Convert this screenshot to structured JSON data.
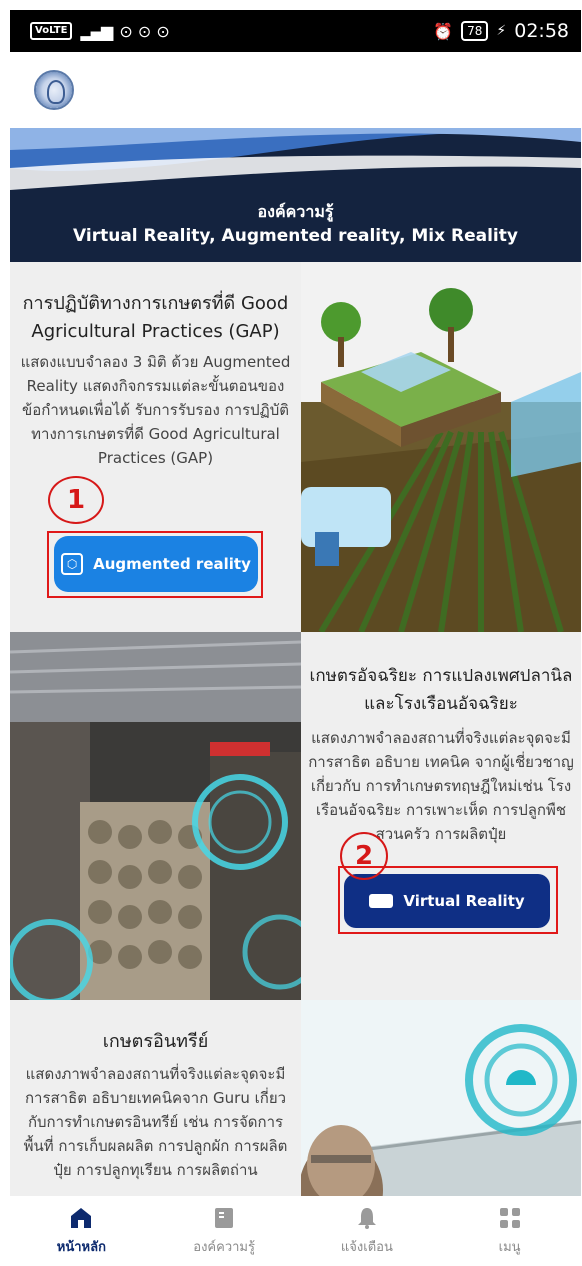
{
  "status_bar": {
    "left_badge": "VoLTE",
    "signal": "📶",
    "icons": "⊙ ⊙ ⊙",
    "battery": "78",
    "time": "02:58"
  },
  "banner": {
    "title": "องค์ความรู้",
    "subtitle": "Virtual Reality, Augmented reality, Mix Reality"
  },
  "cards": [
    {
      "title": "การปฏิบัติทางการเกษตรที่ดี Good Agricultural Practices (GAP)",
      "description": "แสดงแบบจำลอง 3 มิติ ด้วย Augmented Reality แสดงกิจกรรมแต่ละขั้นตอนของข้อกำหนดเพื่อได้ รับการรับรอง การปฏิบัติทางการเกษตรที่ดี Good Agricultural Practices (GAP)",
      "button": "Augmented reality",
      "marker": "1"
    },
    {
      "title": "เกษตรอัจฉริยะ การแปลงเพศปลานิล และโรงเรือนอัจฉริยะ",
      "description": "แสดงภาพจำลองสถานที่จริงแต่ละจุดจะมีการสาธิต อธิบาย เทคนิค จากผู้เชี่ยวชาญเกี่ยวกับ การทำเกษตรทฤษฎีใหม่เช่น โรงเรือนอัจฉริยะ การเพาะเห็ด การปลูกพืชสวนครัว การผลิตปุ๋ย",
      "button": "Virtual Reality",
      "marker": "2"
    },
    {
      "title": "เกษตรอินทรีย์",
      "description": "แสดงภาพจำลองสถานที่จริงแต่ละจุดจะมีการสาธิต อธิบายเทคนิคจาก Guru เกี่ยวกับการทำเกษตรอินทรีย์ เช่น การจัดการพื้นที่ การเก็บผลผลิต การปลูกผัก การผลิตปุ๋ย การปลูกทุเรียน การผลิตถ่าน"
    }
  ],
  "nav": [
    {
      "label": "หน้าหลัก",
      "icon": "home-icon"
    },
    {
      "label": "องค์ความรู้",
      "icon": "book-icon"
    },
    {
      "label": "แจ้งเตือน",
      "icon": "bell-icon"
    },
    {
      "label": "เมนู",
      "icon": "grid-icon"
    }
  ],
  "colors": {
    "nav_active": "#0d2a6e",
    "ar_button": "#1b82e3",
    "vr_button": "#0f2f85",
    "banner": "#14233f"
  }
}
